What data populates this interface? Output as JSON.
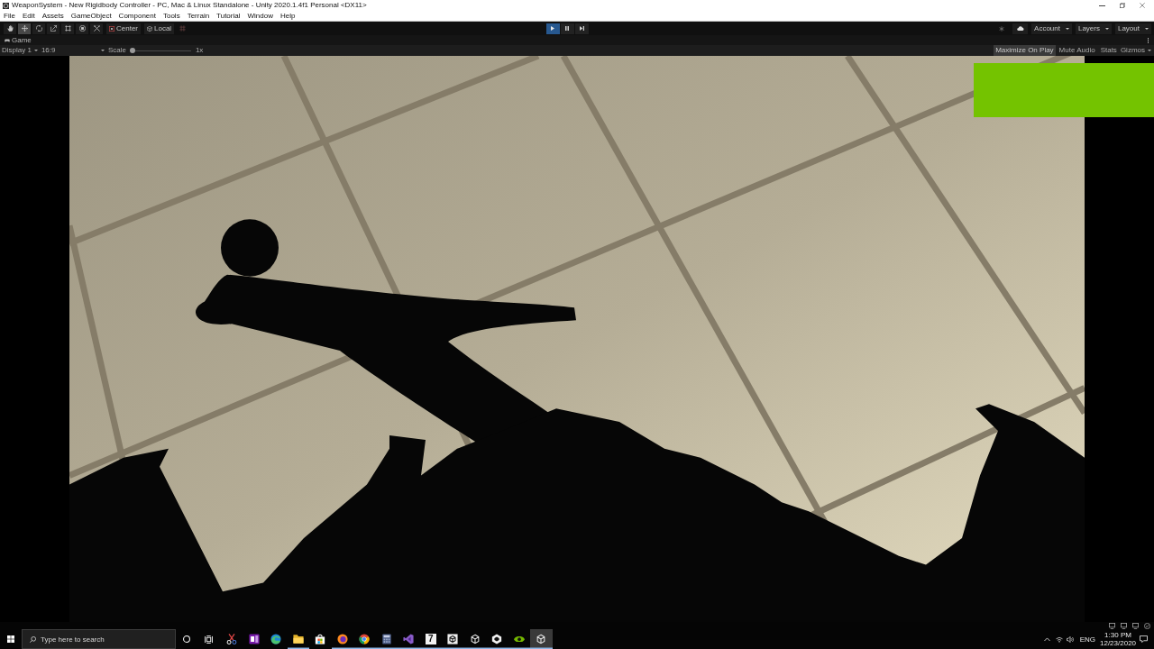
{
  "window": {
    "title": "WeaponSystem - New Rigidbody Controller - PC, Mac & Linux Standalone - Unity 2020.1.4f1 Personal <DX11>"
  },
  "menu": [
    "File",
    "Edit",
    "Assets",
    "GameObject",
    "Component",
    "Tools",
    "Terrain",
    "Tutorial",
    "Window",
    "Help"
  ],
  "toolbar": {
    "tools": [
      {
        "kind": "hand",
        "selected": false
      },
      {
        "kind": "move",
        "selected": true
      },
      {
        "kind": "rotate",
        "selected": false
      },
      {
        "kind": "scale",
        "selected": false
      },
      {
        "kind": "rect",
        "selected": false
      },
      {
        "kind": "transform",
        "selected": false
      },
      {
        "kind": "custom",
        "selected": false
      }
    ],
    "pivot": "Center",
    "space": "Local",
    "playback": [
      {
        "kind": "play",
        "selected": true
      },
      {
        "kind": "pause",
        "selected": false
      },
      {
        "kind": "step",
        "selected": false
      }
    ],
    "dropdowns": [
      "Account",
      "Layers",
      "Layout"
    ]
  },
  "game_tab": {
    "label": "Game"
  },
  "game_toolbar": {
    "display": "Display 1",
    "aspect": "16:9",
    "scale_label": "Scale",
    "scale": {
      "level": 0
    },
    "scale_value": "1x",
    "toggles": [
      {
        "label": "Maximize On Play",
        "on": true
      },
      {
        "label": "Mute Audio",
        "on": false
      },
      {
        "label": "Stats",
        "on": false
      }
    ],
    "gizmos": "Gizmos"
  },
  "taskbar": {
    "search": {
      "placeholder": "Type here to search"
    },
    "apps": [
      {
        "kind": "scissors",
        "running": false,
        "active": false
      },
      {
        "kind": "notebook",
        "running": false,
        "active": false
      },
      {
        "kind": "swirl",
        "running": false,
        "active": false
      },
      {
        "kind": "folder",
        "running": true,
        "active": false
      },
      {
        "kind": "bag",
        "running": false,
        "active": false
      },
      {
        "kind": "globe",
        "running": true,
        "active": false
      },
      {
        "kind": "segments",
        "running": true,
        "active": false
      },
      {
        "kind": "calculator",
        "running": true,
        "active": false
      },
      {
        "kind": "ribbon",
        "running": true,
        "active": false
      },
      {
        "kind": "tile",
        "label": "7",
        "running": true,
        "active": false
      },
      {
        "kind": "cubetile",
        "running": true,
        "active": false
      },
      {
        "kind": "cube",
        "running": true,
        "active": false
      },
      {
        "kind": "hexagon",
        "running": true,
        "active": false
      },
      {
        "kind": "eye",
        "running": true,
        "active": false
      },
      {
        "kind": "cube",
        "running": true,
        "active": true
      }
    ],
    "tray": {
      "language": "ENG",
      "time": "1:30 PM",
      "date": "12/23/2020"
    }
  }
}
